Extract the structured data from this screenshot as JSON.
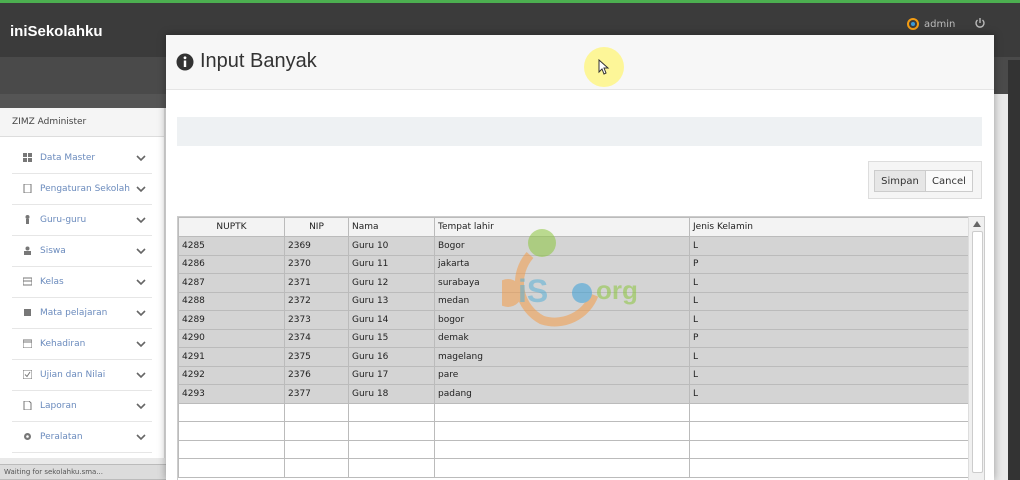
{
  "app": {
    "brand": "iniSekolahku",
    "user": "admin"
  },
  "sidebar": {
    "header": "ZIMZ Administer",
    "items": [
      {
        "label": "Data Master",
        "icon": "grid-icon"
      },
      {
        "label": "Pengaturan Sekolah",
        "icon": "document-icon"
      },
      {
        "label": "Guru-guru",
        "icon": "person-icon"
      },
      {
        "label": "Siswa",
        "icon": "users-icon"
      },
      {
        "label": "Kelas",
        "icon": "table-icon"
      },
      {
        "label": "Mata pelajaran",
        "icon": "book-icon"
      },
      {
        "label": "Kehadiran",
        "icon": "calendar-icon"
      },
      {
        "label": "Ujian dan Nilai",
        "icon": "checkbox-icon"
      },
      {
        "label": "Laporan",
        "icon": "file-icon"
      },
      {
        "label": "Peralatan",
        "icon": "gear-icon"
      }
    ]
  },
  "status": "Waiting for sekolahku.sma...",
  "modal": {
    "title": "Input Banyak",
    "buttons": {
      "save": "Simpan",
      "cancel": "Cancel"
    },
    "columns": [
      "NUPTK",
      "NIP",
      "Nama",
      "Tempat lahir",
      "Jenis Kelamin"
    ],
    "rows": [
      [
        "4285",
        "2369",
        "Guru 10",
        "Bogor",
        "L"
      ],
      [
        "4286",
        "2370",
        "Guru 11",
        "jakarta",
        "P"
      ],
      [
        "4287",
        "2371",
        "Guru 12",
        "surabaya",
        "L"
      ],
      [
        "4288",
        "2372",
        "Guru 13",
        "medan",
        "L"
      ],
      [
        "4289",
        "2373",
        "Guru 14",
        "bogor",
        "L"
      ],
      [
        "4290",
        "2374",
        "Guru 15",
        "demak",
        "P"
      ],
      [
        "4291",
        "2375",
        "Guru 16",
        "magelang",
        "L"
      ],
      [
        "4292",
        "2376",
        "Guru 17",
        "pare",
        "L"
      ],
      [
        "4293",
        "2377",
        "Guru 18",
        "padang",
        "L"
      ]
    ],
    "empty_rows": 4
  },
  "watermark": {
    "text": "iS",
    "org": "org"
  },
  "colors": {
    "topbar": "#3b3b3b",
    "accent": "#4caf50",
    "menu_text": "#6b8bbd",
    "filled_row": "#d4d4d4"
  }
}
